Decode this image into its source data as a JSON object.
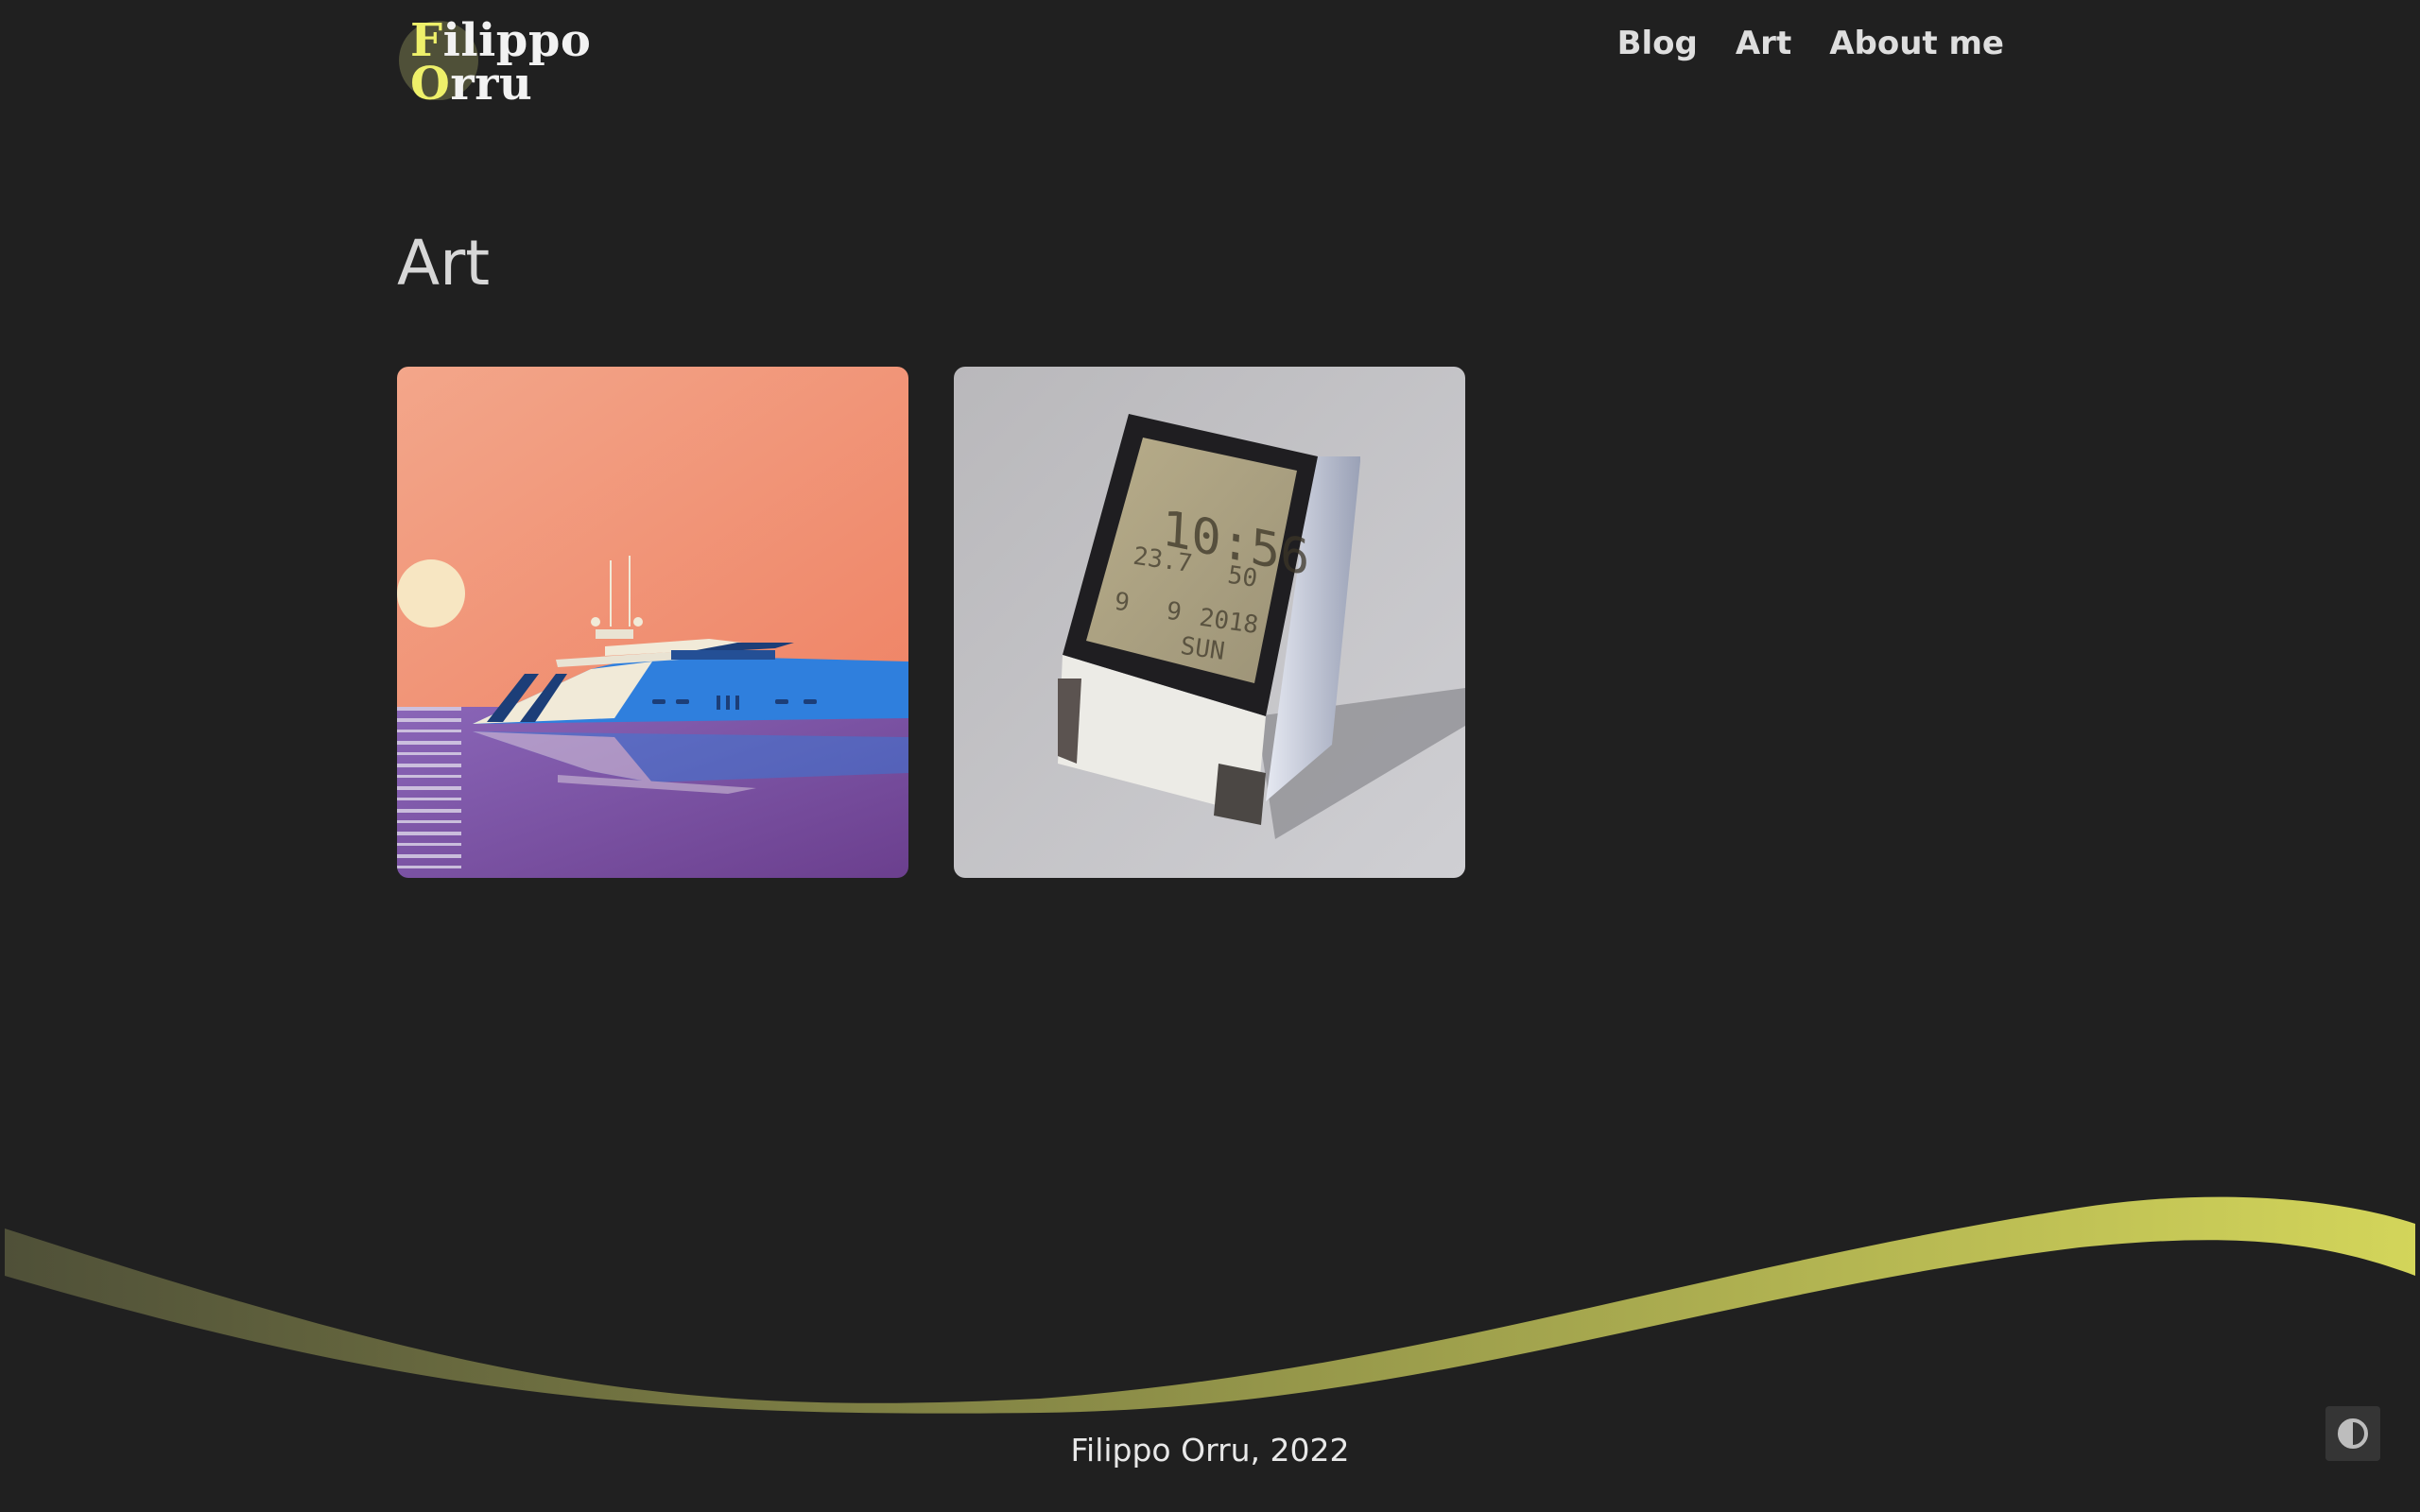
{
  "header": {
    "logo": {
      "line1": "Filippo",
      "line2": "Orru",
      "accent_color": "#eef06a"
    },
    "nav": [
      {
        "label": "Blog"
      },
      {
        "label": "Art"
      },
      {
        "label": "About me"
      }
    ]
  },
  "main": {
    "title": "Art",
    "gallery": [
      {
        "subject": "yacht-at-sunset-illustration"
      },
      {
        "subject": "digital-clock-photo",
        "clock_time": "10:56",
        "clock_lines": [
          "23.7",
          "50",
          "9",
          "9",
          "2018",
          "SUN"
        ]
      }
    ]
  },
  "footer": {
    "copyright": "Filippo Orru, 2022",
    "wave_colors": [
      "#4f5038",
      "#d3d55a"
    ],
    "theme_toggle_icon": "half-circle-contrast-icon"
  }
}
